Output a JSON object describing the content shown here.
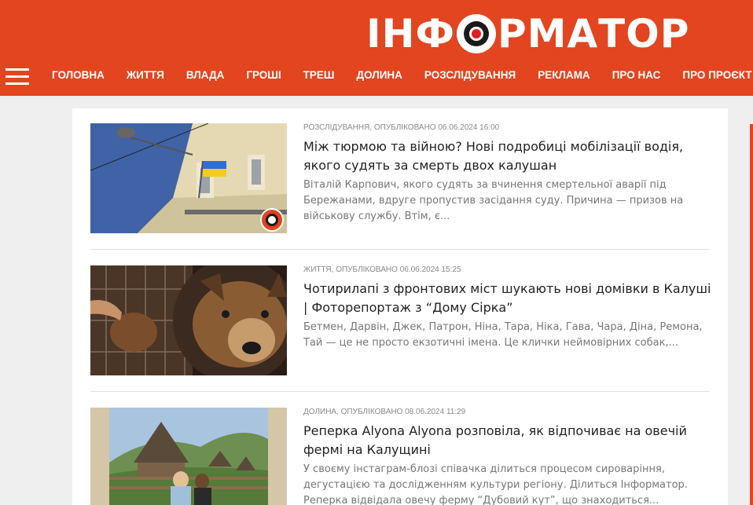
{
  "header": {
    "logo": {
      "part1": "ІНФ",
      "part2": "РМАТОР"
    },
    "nav": [
      "ГОЛОВНА",
      "ЖИТТЯ",
      "ВЛАДА",
      "ГРОШІ",
      "ТРЕШ",
      "ДОЛИНА",
      "РОЗСЛІДУВАННЯ",
      "РЕКЛАМА",
      "ПРО НАС",
      "ПРО ПРОЄКТ"
    ]
  },
  "colors": {
    "brand": "#e2451f",
    "text": "#222222",
    "meta": "#8a8a8a",
    "excerpt": "#777777"
  },
  "articles": [
    {
      "meta": "РОЗСЛІДУВАННЯ, ОПУБЛІКОВАНО 06.06.2024 16:00",
      "title": "Між тюрмою та війною? Нові подробиці мобілізації водія, якого судять за смерть двох калушан",
      "excerpt": "Віталій Карпович, якого судять за вчинення смертельної аварії під Бережанами, вдруге пропустив засідання суду. Причина — призов на військову службу. Втім, є..."
    },
    {
      "meta": "ЖИТТЯ, ОПУБЛІКОВАНО 06.06.2024 15:25",
      "title": "Чотирилапі з фронтових міст шукають нові домівки в Калуші | Фоторепортаж з “Дому Сірка”",
      "excerpt": "Бетмен, Дарвін, Джек, Патрон, Ніна, Тара, Ніка, Гава, Чара, Діна, Ремона, Тай — це не просто екзотичні імена. Це клички неймовірних собак,..."
    },
    {
      "meta": "ДОЛИНА, ОПУБЛІКОВАНО 08.06.2024 11:29",
      "title": "Реперка Alyona Alyona розповіла, як відпочиває на овечій фермі на Калущині",
      "excerpt": "У своєму інстаграм-блозі співачка ділиться процесом сироваріння, дегустацією та дослідженням культури регіону. Ділиться Інформатор. Реперка відвідала овечу ферму “Дубовий кут”, що знаходиться..."
    }
  ]
}
